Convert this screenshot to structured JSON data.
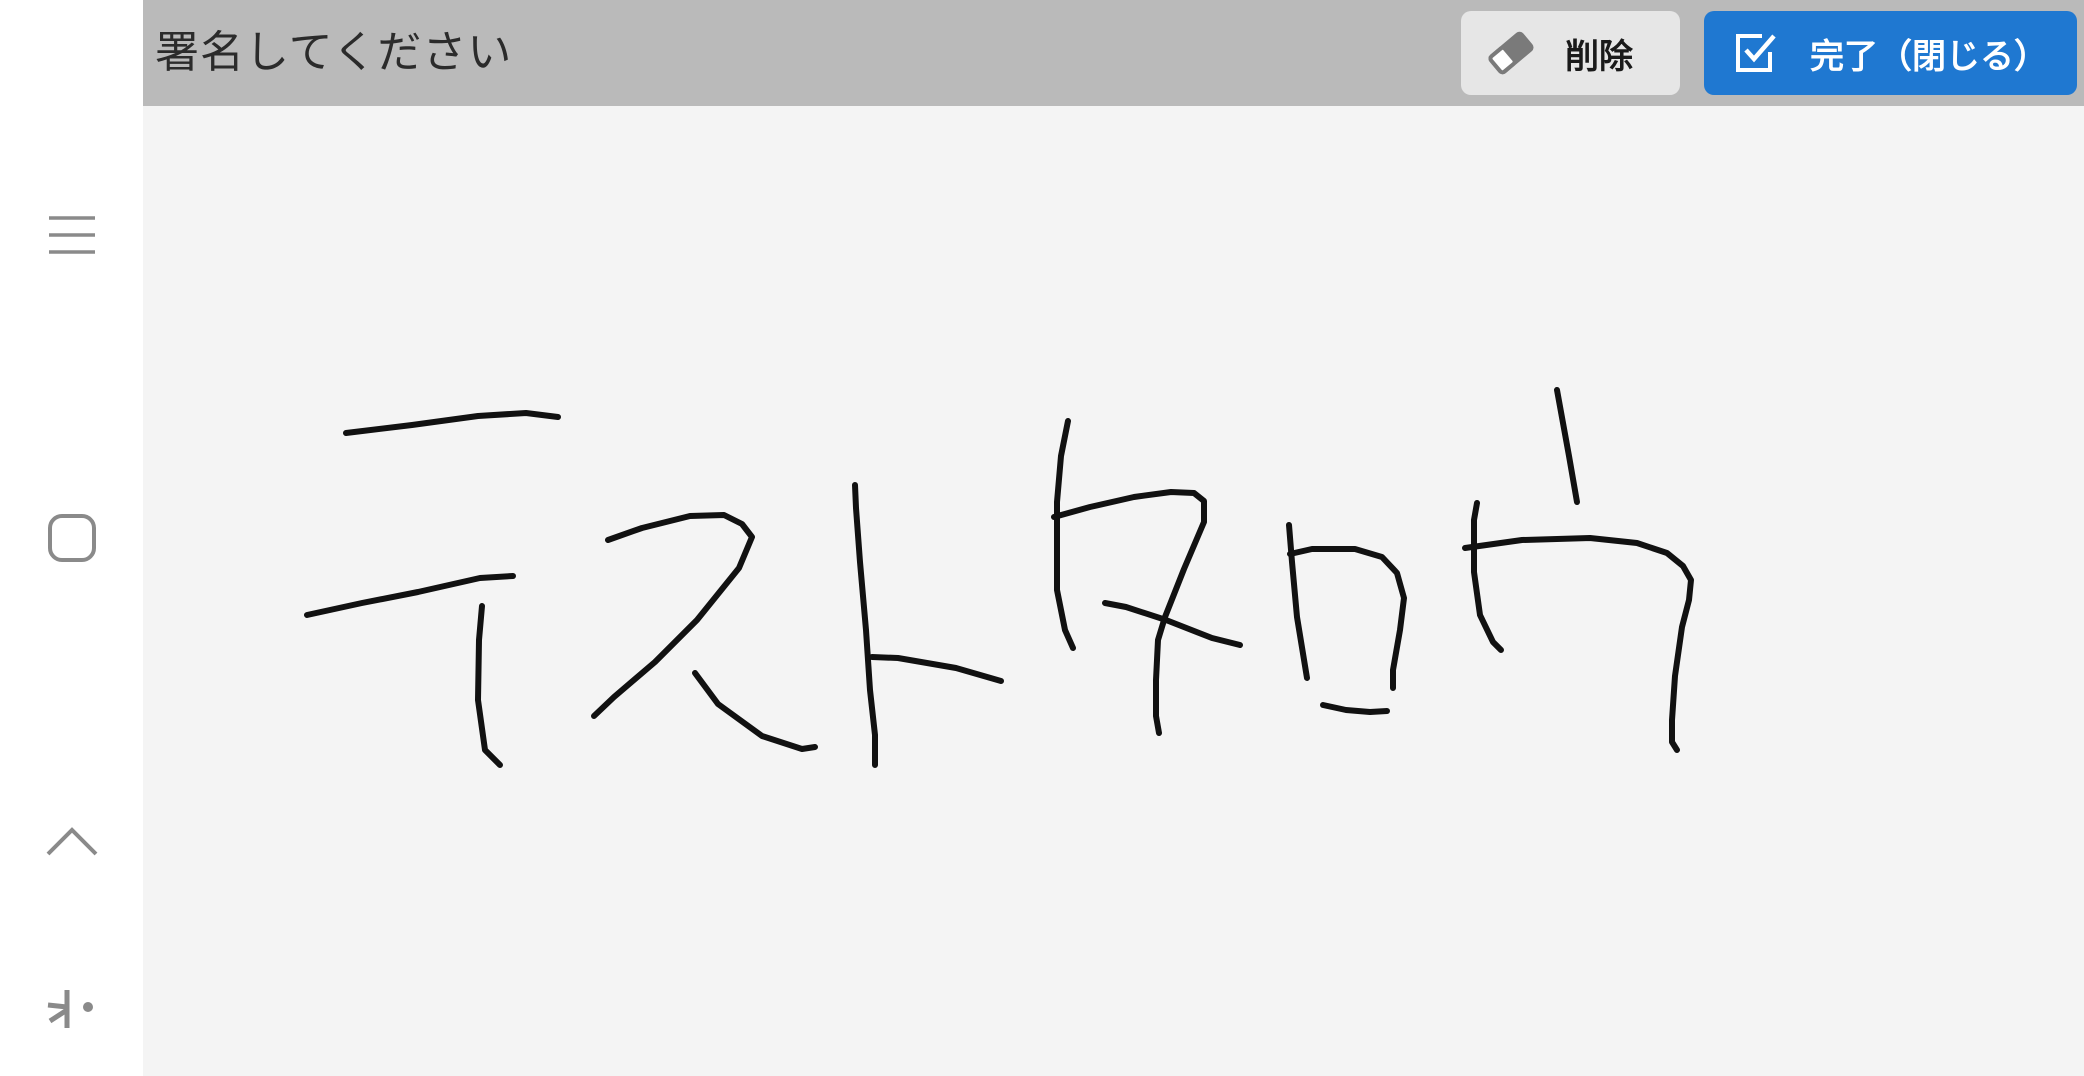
{
  "header": {
    "title": "署名してください",
    "clear_button_label": "削除",
    "done_button_label": "完了（閉じる）"
  },
  "signature": {
    "handwritten_text": "テストタロウ",
    "stroke_color": "#111111"
  },
  "nav_bar": {
    "buttons": [
      {
        "icon": "recent-apps-icon"
      },
      {
        "icon": "home-icon"
      },
      {
        "icon": "back-icon"
      },
      {
        "icon": "accessibility-icon"
      }
    ]
  },
  "colors": {
    "header_bg": "#bababa",
    "canvas_bg": "#f4f4f4",
    "done_button_bg": "#1f78d1",
    "clear_button_bg": "#e6e6e6"
  }
}
